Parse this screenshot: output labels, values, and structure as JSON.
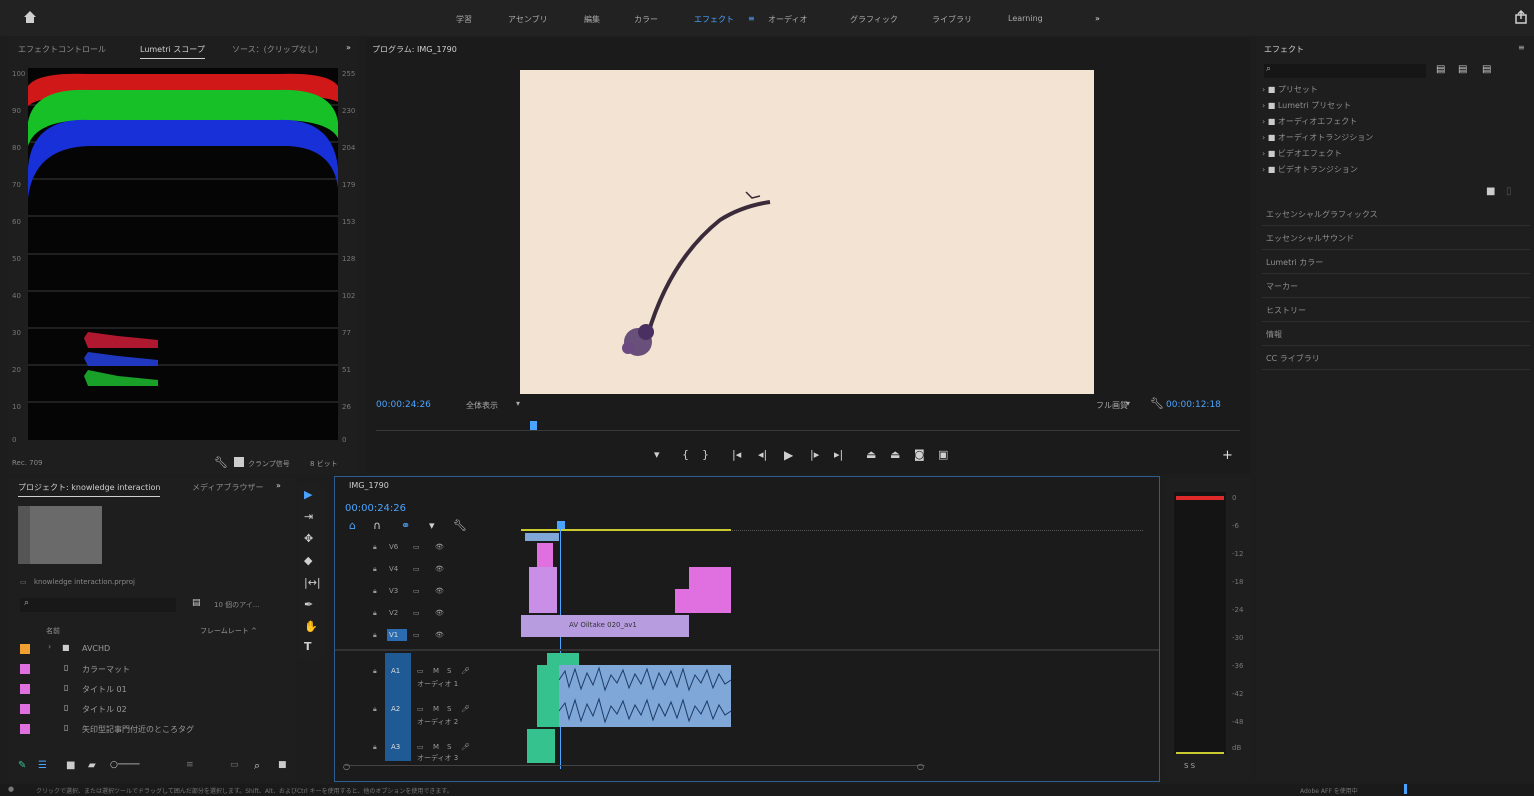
{
  "topbar": {
    "workspaces": [
      "学習",
      "アセンブリ",
      "編集",
      "カラー",
      "エフェクト",
      "オーディオ",
      "グラフィック",
      "ライブラリ",
      "Learning"
    ],
    "active": "エフェクト",
    "more": "»"
  },
  "scopes": {
    "tabs": [
      "エフェクトコントロール",
      "Lumetri スコープ",
      "ソース：(クリップなし)"
    ],
    "more": "»",
    "left_ticks": [
      "100",
      "90",
      "80",
      "70",
      "60",
      "50",
      "40",
      "30",
      "20",
      "10",
      "0"
    ],
    "right_ticks": [
      "255",
      "230",
      "204",
      "179",
      "153",
      "128",
      "102",
      "77",
      "51",
      "26",
      "0"
    ],
    "bottom_left": "Rec. 709",
    "clamp_label": "クランプ信号",
    "bitdepth": "8 ビット"
  },
  "program": {
    "title": "プログラム: IMG_1790",
    "timecode": "00:00:24:26",
    "fit": "全体表示",
    "quality": "フル画質",
    "duration": "00:00:12:18"
  },
  "project": {
    "tabs": [
      "プロジェクト: knowledge interaction",
      "メディアブラウザー"
    ],
    "more": "»",
    "file": "knowledge interaction.prproj",
    "count": "10 個のアイ...",
    "col_name": "名前",
    "col_rate": "フレームレート ^",
    "items": [
      {
        "name": "AVCHD",
        "color": "#f0a030",
        "folder": true
      },
      {
        "name": "カラーマット",
        "color": "#e070e0",
        "folder": false
      },
      {
        "name": "タイトル 01",
        "color": "#e070e0",
        "folder": false
      },
      {
        "name": "タイトル 02",
        "color": "#e070e0",
        "folder": false
      },
      {
        "name": "矢印型記事門付近のところタグ",
        "color": "#e070e0",
        "folder": false
      }
    ]
  },
  "timeline": {
    "tab": "IMG_1790",
    "timecode": "00:00:24:26",
    "video_tracks": [
      "V6",
      "V4",
      "V3",
      "V2",
      "V1"
    ],
    "audio_tracks": [
      "A1",
      "A2",
      "A3"
    ],
    "audio_label": "オーディオ 1",
    "audio_label2": "オーディオ 2",
    "audio_label3": "オーディオ 3",
    "clip_name": "AV Oiltake 020_av1"
  },
  "effects": {
    "title": "エフェクト",
    "folders": [
      "プリセット",
      "Lumetri プリセット",
      "オーディオエフェクト",
      "オーディオトランジション",
      "ビデオエフェクト",
      "ビデオトランジション"
    ],
    "sections": [
      "エッセンシャルグラフィックス",
      "エッセンシャルサウンド",
      "Lumetri カラー",
      "マーカー",
      "ヒストリー",
      "情報",
      "CC ライブラリ"
    ]
  },
  "meter": {
    "ticks": [
      "0",
      "-6",
      "-12",
      "-18",
      "-24",
      "-30",
      "-36",
      "-42",
      "-48",
      "dB"
    ],
    "sr": "S S"
  },
  "status": {
    "text": "クリックで選択、または選択ツールでドラッグして囲んだ部分を選択します。Shift、Alt、およびCtrl キーを使用すると、他のオプションを使用できます。",
    "right": "Adobe AFF を使用中"
  },
  "colors": {
    "accent": "#4aa3ff",
    "pink": "#c98fe6",
    "blue": "#2b6cb0",
    "green": "#36c28f",
    "audio": "#7fa7d8"
  }
}
